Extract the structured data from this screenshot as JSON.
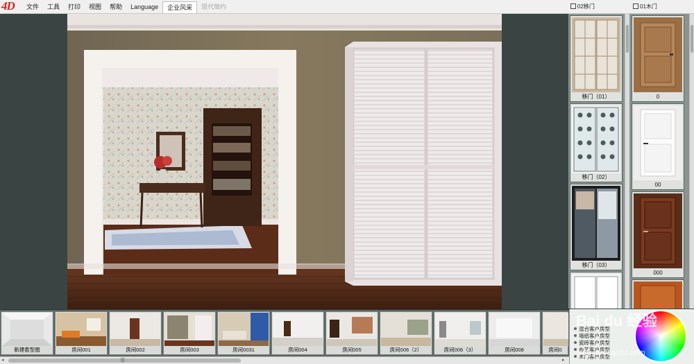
{
  "app": {
    "logo_text": "4D"
  },
  "menu": {
    "items": [
      "文件",
      "工具",
      "打印",
      "视图",
      "帮助",
      "Language",
      "企业风采",
      "现代简约"
    ]
  },
  "panels": {
    "col1_title": "02移门",
    "col2_title": "01木门"
  },
  "col1_cards": [
    {
      "caption": "移门（01）"
    },
    {
      "caption": "移门（02）"
    },
    {
      "caption": "移门（03）"
    },
    {
      "caption": ""
    }
  ],
  "col2_cards": [
    {
      "caption": "0"
    },
    {
      "caption": "00"
    },
    {
      "caption": "000"
    },
    {
      "caption": ""
    }
  ],
  "rooms": [
    {
      "caption": "新建套型图"
    },
    {
      "caption": "房间001"
    },
    {
      "caption": "房间002"
    },
    {
      "caption": "房间003"
    },
    {
      "caption": "房间0031"
    },
    {
      "caption": "房间004"
    },
    {
      "caption": "房间005"
    },
    {
      "caption": "房间006（2）"
    },
    {
      "caption": "房间006（3）"
    },
    {
      "caption": "房间008"
    },
    {
      "caption": "房间0"
    }
  ],
  "selected_room": "房间003",
  "style_list": [
    "混合客户房型",
    "墙纸客户房型",
    "瓷砖客户房型",
    "布艺客户房型",
    "木门客户房型"
  ],
  "watermark": {
    "text": "jingyan.baidu.com",
    "brand": "Bai du 经验"
  },
  "colors": {
    "menubar": "#f0f0f0",
    "background": "#3a4543",
    "panel": "#8a9590",
    "strip": "#5b6662",
    "logo": "#e02020"
  }
}
